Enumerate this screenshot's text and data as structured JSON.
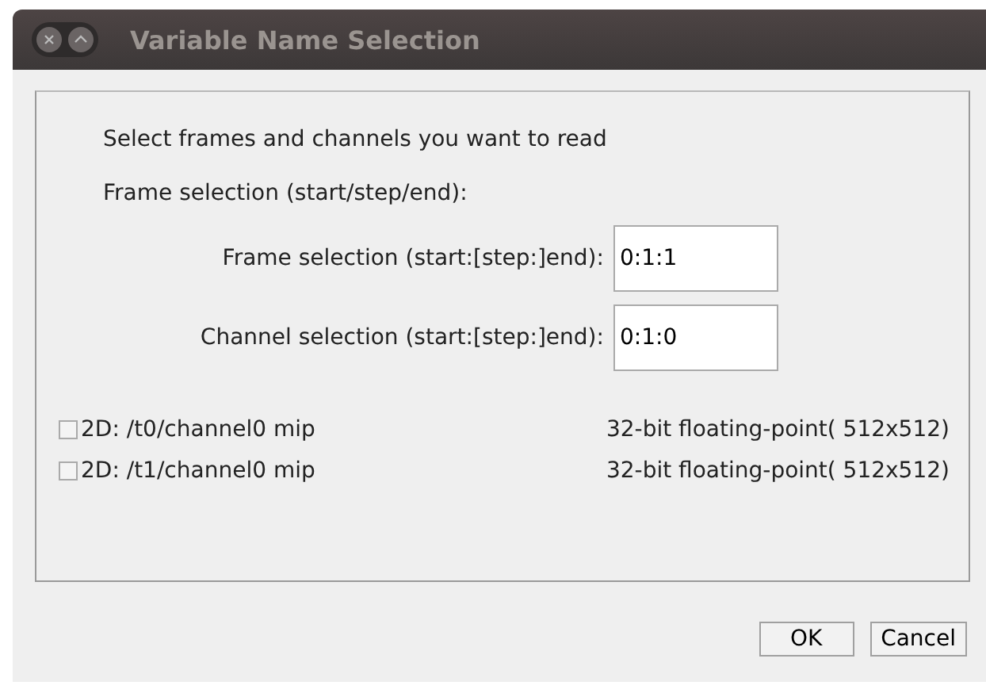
{
  "window": {
    "title": "Variable Name Selection"
  },
  "intro": "Select frames and channels you want to read",
  "section_label": "Frame selection (start/step/end):",
  "fields": [
    {
      "label": "Frame selection (start:[step:]end):",
      "value": "0:1:1"
    },
    {
      "label": "Channel selection (start:[step:]end):",
      "value": "0:1:0"
    }
  ],
  "variables": [
    {
      "name": "2D: /t0/channel0 mip",
      "type": "32-bit floating-point( 512x512)",
      "checked": false
    },
    {
      "name": "2D: /t1/channel0 mip",
      "type": "32-bit floating-point( 512x512)",
      "checked": false
    }
  ],
  "buttons": [
    "OK",
    "Cancel"
  ]
}
